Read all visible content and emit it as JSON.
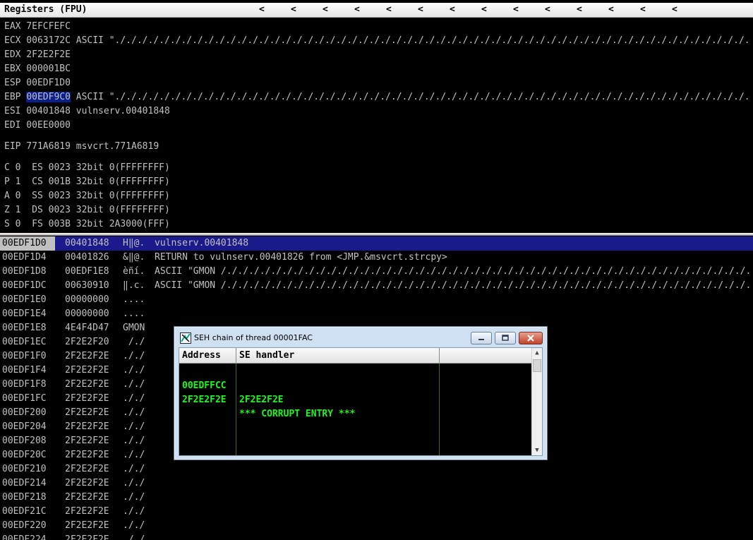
{
  "registers": {
    "title": "Registers (FPU)",
    "arrow": "<",
    "lines": [
      "EAX 7EFCFEFC",
      "ECX 0063172C ASCII \"./././././././././././././././././././././././././././././././././././././././././././././././././././././././././.",
      "EDX 2F2E2F2E",
      "EBX 000001BC",
      "ESP 00EDF1D0",
      "",
      "ESI 00401848 vulnserv.00401848",
      "EDI 00EE0000",
      "EIP 771A6819 msvcrt.771A6819",
      "C 0  ES 0023 32bit 0(FFFFFFFF)",
      "P 1  CS 001B 32bit 0(FFFFFFFF)",
      "A 0  SS 0023 32bit 0(FFFFFFFF)",
      "Z 1  DS 0023 32bit 0(FFFFFFFF)",
      "S 0  FS 003B 32bit 2A3000(FFF)"
    ],
    "ebp": {
      "label": "EBP ",
      "value": "00EDF9C0",
      "rest": " ASCII \"./././././././././././././././././././././././././././././././././././././././././././././././././././././././././."
    }
  },
  "stack": {
    "rows": [
      {
        "addr": "00EDF1D0",
        "val": "00401848",
        "asc": "H‖@.",
        "cmt": "vulnserv.00401848"
      },
      {
        "addr": "00EDF1D4",
        "val": "00401826",
        "asc": "&‖@.",
        "cmt": "RETURN to vulnserv.00401826 from <JMP.&msvcrt.strcpy>"
      },
      {
        "addr": "00EDF1D8",
        "val": "00EDF1E8",
        "asc": "èñí.",
        "cmt": "ASCII \"GMON /./././././././././././././././././././././././././././././././././././././././././././././././."
      },
      {
        "addr": "00EDF1DC",
        "val": "00630910",
        "asc": "‖.c.",
        "cmt": "ASCII \"GMON /./././././././././././././././././././././././././././././././././././././././././././././././."
      },
      {
        "addr": "00EDF1E0",
        "val": "00000000",
        "asc": "....",
        "cmt": ""
      },
      {
        "addr": "00EDF1E4",
        "val": "00000000",
        "asc": "....",
        "cmt": ""
      },
      {
        "addr": "00EDF1E8",
        "val": "4E4F4D47",
        "asc": "GMON",
        "cmt": ""
      },
      {
        "addr": "00EDF1EC",
        "val": "2F2E2F20",
        "asc": " /./",
        "cmt": ""
      },
      {
        "addr": "00EDF1F0",
        "val": "2F2E2F2E",
        "asc": "././",
        "cmt": ""
      },
      {
        "addr": "00EDF1F4",
        "val": "2F2E2F2E",
        "asc": "././",
        "cmt": ""
      },
      {
        "addr": "00EDF1F8",
        "val": "2F2E2F2E",
        "asc": "././",
        "cmt": ""
      },
      {
        "addr": "00EDF1FC",
        "val": "2F2E2F2E",
        "asc": "././",
        "cmt": ""
      },
      {
        "addr": "00EDF200",
        "val": "2F2E2F2E",
        "asc": "././",
        "cmt": ""
      },
      {
        "addr": "00EDF204",
        "val": "2F2E2F2E",
        "asc": "././",
        "cmt": ""
      },
      {
        "addr": "00EDF208",
        "val": "2F2E2F2E",
        "asc": "././",
        "cmt": ""
      },
      {
        "addr": "00EDF20C",
        "val": "2F2E2F2E",
        "asc": "././",
        "cmt": ""
      },
      {
        "addr": "00EDF210",
        "val": "2F2E2F2E",
        "asc": "././",
        "cmt": ""
      },
      {
        "addr": "00EDF214",
        "val": "2F2E2F2E",
        "asc": "././",
        "cmt": ""
      },
      {
        "addr": "00EDF218",
        "val": "2F2E2F2E",
        "asc": "././",
        "cmt": ""
      },
      {
        "addr": "00EDF21C",
        "val": "2F2E2F2E",
        "asc": "././",
        "cmt": ""
      },
      {
        "addr": "00EDF220",
        "val": "2F2E2F2E",
        "asc": "././",
        "cmt": ""
      },
      {
        "addr": "00EDF224",
        "val": "2F2E2F2E",
        "asc": "././",
        "cmt": ""
      }
    ]
  },
  "seh": {
    "title": "SEH chain of thread 00001FAC",
    "columns": {
      "address": "Address",
      "handler": "SE handler"
    },
    "rows": [
      {
        "address": "00EDFFCC",
        "handler": "2F2E2F2E"
      },
      {
        "address": "2F2E2F2E",
        "handler": "*** CORRUPT ENTRY ***"
      }
    ]
  },
  "colors": {
    "accent_green": "#1df51d",
    "selection_blue": "#1a1a8c"
  }
}
